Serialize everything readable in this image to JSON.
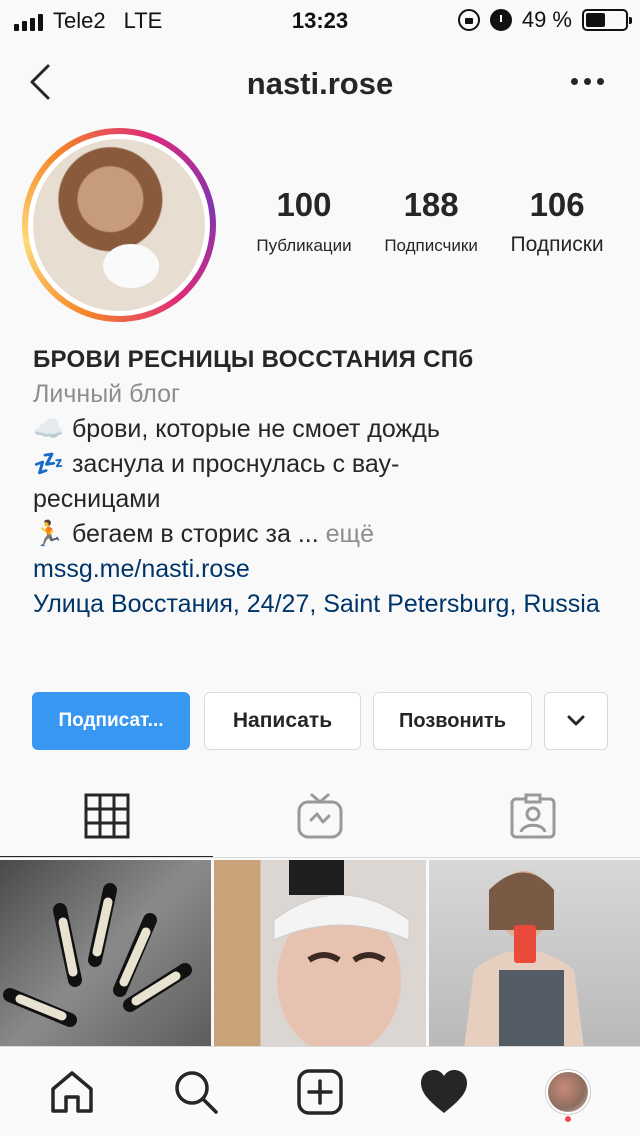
{
  "status_bar": {
    "carrier": "Tele2",
    "network": "LTE",
    "time": "13:23",
    "battery_percent": "49 %",
    "battery_level": 0.49
  },
  "nav": {
    "title": "nasti.rose"
  },
  "profile": {
    "stats": [
      {
        "value": "100",
        "label": "Публикации"
      },
      {
        "value": "188",
        "label": "Подписчики"
      },
      {
        "value": "106",
        "label": "Подписки"
      }
    ]
  },
  "bio": {
    "name": "БРОВИ РЕСНИЦЫ ВОССТАНИЯ СПб",
    "category": "Личный блог",
    "line1_emoji": "☁️",
    "line1": "брови, которые не смоет дождь",
    "line2_emoji": "💤",
    "line2": "заснула и проснулась с вау-",
    "line3": "ресницами",
    "line4_emoji": "🏃",
    "line4": "бегаем в сторис за ...",
    "more": "ещё",
    "link": "mssg.me/nasti.rose",
    "address": "Улица Восстания, 24/27, Saint Petersburg, Russia"
  },
  "actions": {
    "follow": "Подписат...",
    "message": "Написать",
    "call": "Позвонить"
  },
  "tabs": [
    "grid-icon",
    "igtv-icon",
    "tagged-icon"
  ],
  "bottom_bar": [
    "home-icon",
    "search-icon",
    "add-post-icon",
    "activity-heart-icon",
    "profile-avatar"
  ]
}
